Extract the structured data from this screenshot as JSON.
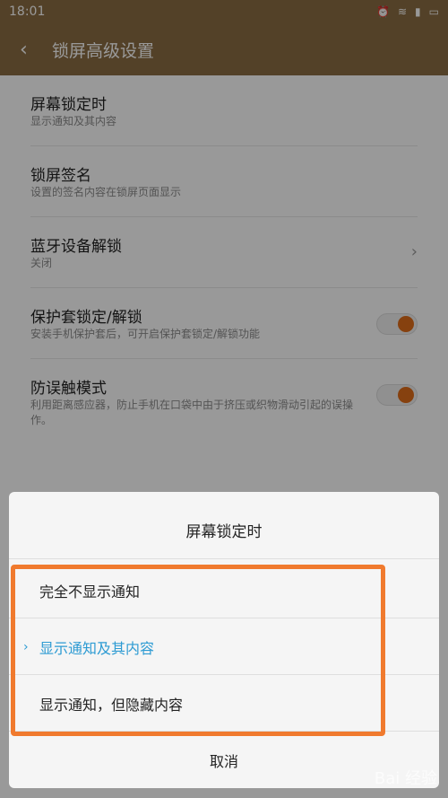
{
  "status": {
    "time": "18:01",
    "icons": [
      "alarm-icon",
      "wifi-icon",
      "signal-icon",
      "battery-icon"
    ]
  },
  "appbar": {
    "back_icon": "back-icon",
    "title": "锁屏高级设置"
  },
  "settings": [
    {
      "title": "屏幕锁定时",
      "subtitle": "显示通知及其内容"
    },
    {
      "title": "锁屏签名",
      "subtitle": "设置的签名内容在锁屏页面显示"
    },
    {
      "title": "蓝牙设备解锁",
      "subtitle": "关闭"
    },
    {
      "title": "保护套锁定/解锁",
      "subtitle": "安装手机保护套后，可开启保护套锁定/解锁功能"
    },
    {
      "title": "防误触模式",
      "subtitle": "利用距离感应器，防止手机在口袋中由于挤压或织物滑动引起的误操作。"
    }
  ],
  "dialog": {
    "title": "屏幕锁定时",
    "options": [
      {
        "label": "完全不显示通知",
        "selected": false
      },
      {
        "label": "显示通知及其内容",
        "selected": true
      },
      {
        "label": "显示通知，但隐藏内容",
        "selected": false
      }
    ],
    "cancel": "取消"
  },
  "watermark": "Bai 经验",
  "colors": {
    "header": "#8a6d44",
    "accent": "#2d9bd3",
    "toggle": "#e06d1a",
    "highlight": "#f07a2e"
  }
}
